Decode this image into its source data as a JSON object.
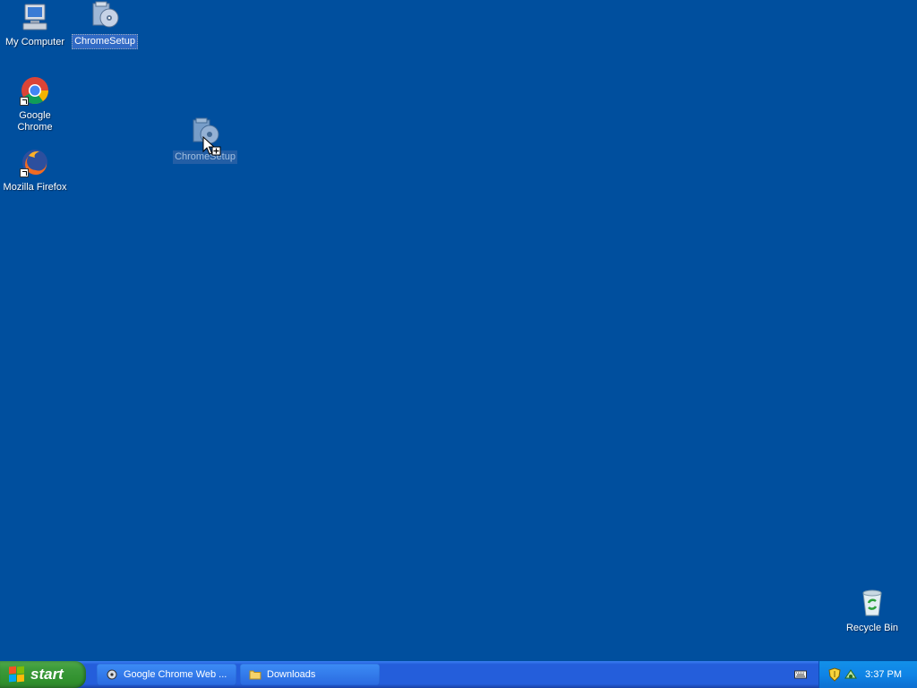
{
  "desktop": {
    "background_color": "#004f9e",
    "icons": {
      "my_computer": "My Computer",
      "chrome_setup": "ChromeSetup",
      "google_chrome": "Google Chrome",
      "mozilla_firefox": "Mozilla Firefox",
      "chrome_setup_dragging": "ChromeSetup",
      "recycle_bin": "Recycle Bin"
    }
  },
  "taskbar": {
    "start_label": "start",
    "tasks": [
      {
        "label": "Google Chrome Web ...",
        "icon": "installer-icon"
      },
      {
        "label": "Downloads",
        "icon": "folder-icon"
      }
    ],
    "tray": {
      "icons": [
        "keyboard-icon",
        "security-shield-icon",
        "network-icon"
      ],
      "clock": "3:37 PM"
    }
  }
}
